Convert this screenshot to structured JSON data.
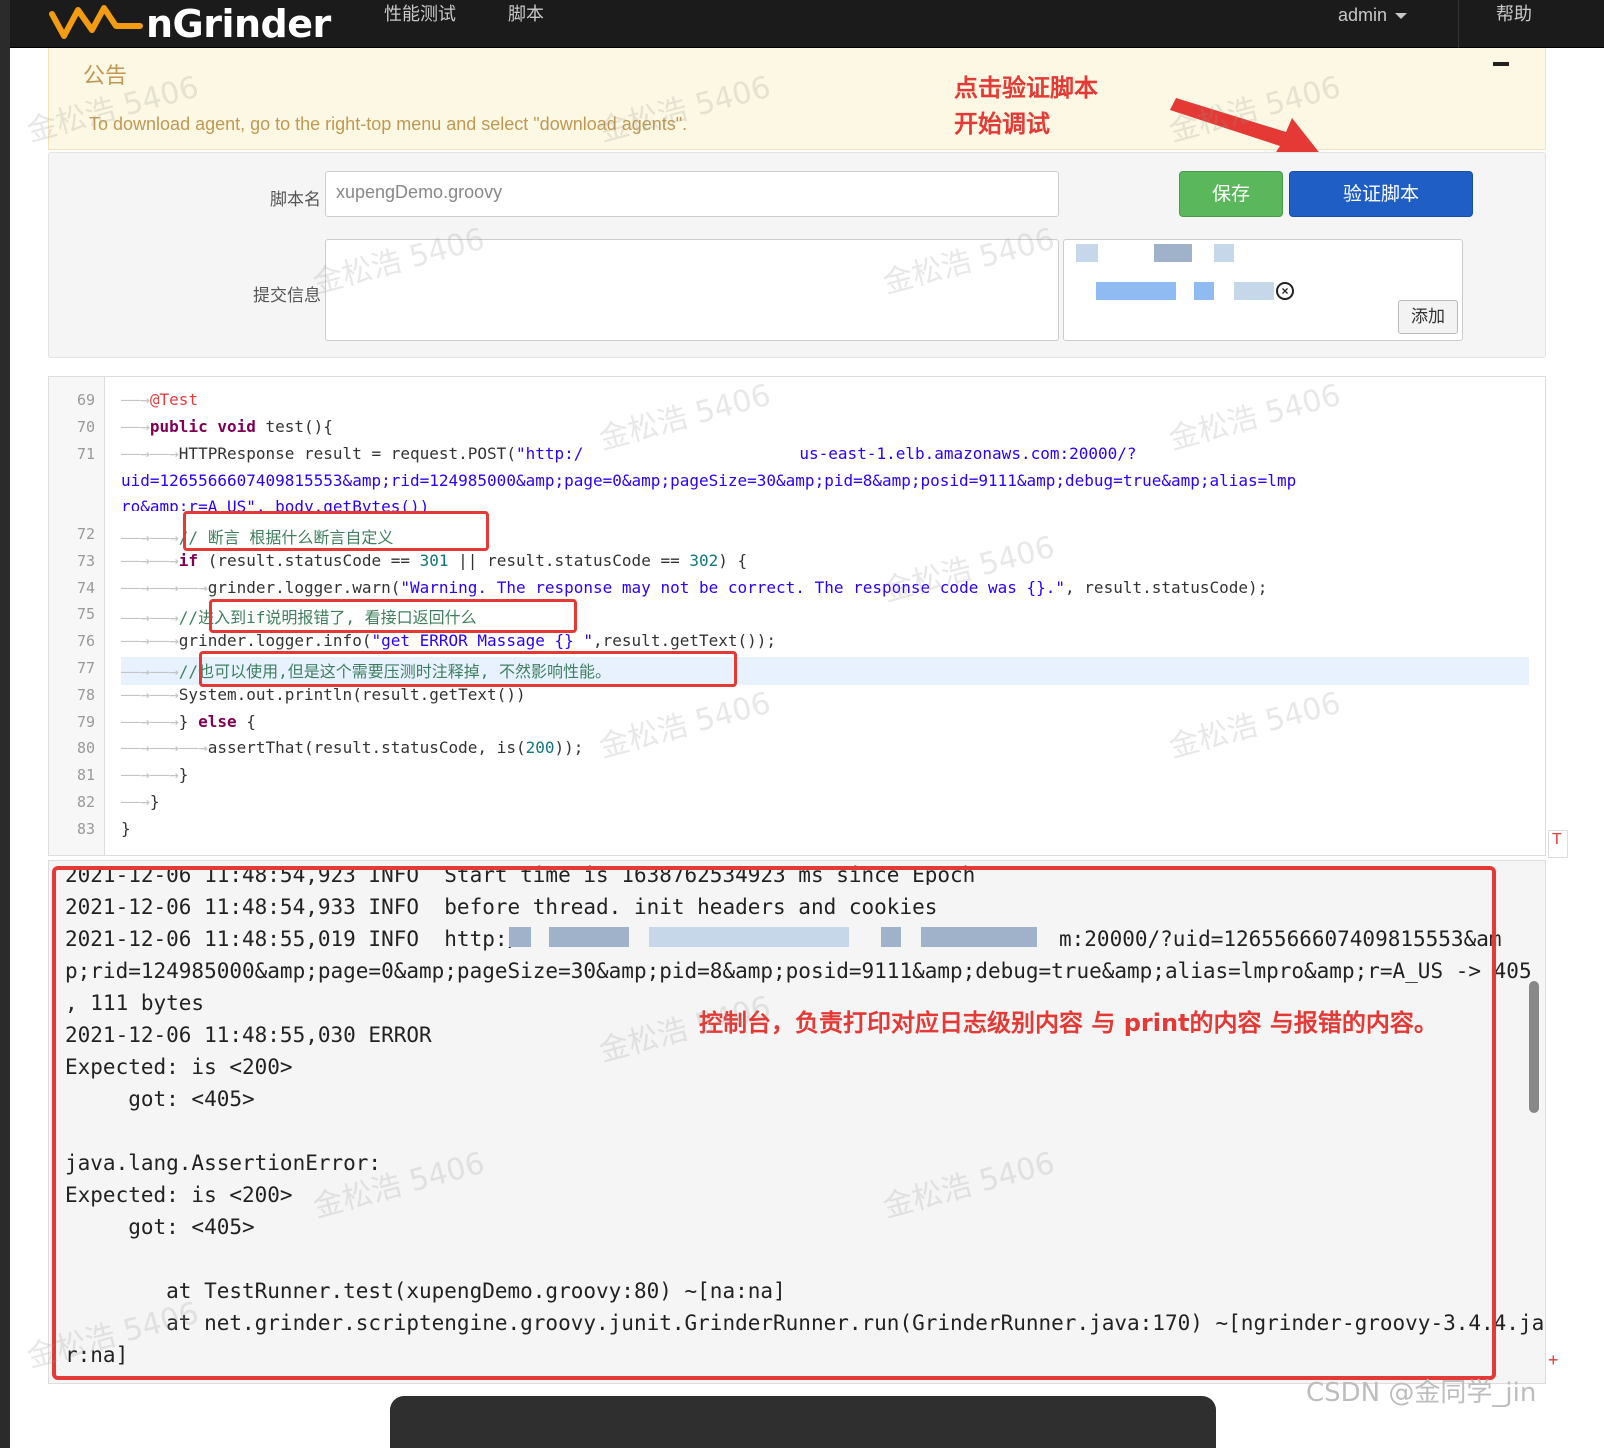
{
  "navbar": {
    "brand": "nGrinder",
    "menu": [
      "性能测试",
      "脚本"
    ],
    "user": "admin",
    "help": "帮助"
  },
  "notice": {
    "title": "公告",
    "text": "To download agent, go to the right-top menu and select \"download agents\"."
  },
  "annotations": {
    "verify_hint_1": "点击验证脚本",
    "verify_hint_2": "开始调试",
    "console_hint": "控制台，负责打印对应日志级别内容 与 print的内容 与报错的内容。"
  },
  "form": {
    "script_name_label": "脚本名",
    "script_name_value": "xupengDemo.groovy",
    "commit_label": "提交信息",
    "commit_value": "",
    "save_label": "保存",
    "verify_label": "验证脚本",
    "add_label": "添加"
  },
  "editor": {
    "line_numbers": [
      "69",
      "70",
      "71",
      "72",
      "73",
      "74",
      "75",
      "76",
      "77",
      "78",
      "79",
      "80",
      "81",
      "82",
      "83"
    ],
    "lines": {
      "l69_annotation": "@Test",
      "l70_kw": "public void",
      "l70_rest": " test(){",
      "l71_a": "HTTPResponse result = request.POST(",
      "l71_url1": "\"http:/",
      "l71_url2": "us-east-1.elb.amazonaws.com:20000/?",
      "l71_cont": "uid=1265566607409815553&amp;rid=124985000&amp;page=0&amp;pageSize=30&amp;pid=8&amp;posid=9111&amp;debug=true&amp;alias=lmp",
      "l71_cont2": "ro&amp;r=A_US\", body.getBytes())",
      "l72_comment": "// 断言 根据什么断言自定义",
      "l73_kw": "if",
      "l73_a": " (result.statusCode == ",
      "l73_n1": "301",
      "l73_b": " || result.statusCode == ",
      "l73_n2": "302",
      "l73_c": ") {",
      "l74_a": "grinder.logger.warn(",
      "l74_str": "\"Warning. The response may not be correct. The response code was {}.\"",
      "l74_b": ", result.statusCode);",
      "l75_comment": "//进入到if说明报错了, 看接口返回什么",
      "l76_a": "grinder.logger.info(",
      "l76_str": "\"get ERROR Massage {} \"",
      "l76_b": ",result.getText());",
      "l77_comment": "//也可以使用,但是这个需要压测时注释掉, 不然影响性能。",
      "l78": "System.out.println(result.getText())",
      "l79_a": "} ",
      "l79_kw": "else",
      "l79_b": " {",
      "l80_a": "assertThat(result.statusCode, is(",
      "l80_n": "200",
      "l80_b": "));",
      "l81": "}",
      "l82": "}",
      "l83": "}"
    }
  },
  "console": {
    "lines": [
      "2021-12-06 11:48:54,923 INFO  Start time is 1638762534923 ms since Epoch",
      "2021-12-06 11:48:54,933 INFO  before thread. init headers and cookies",
      "2021-12-06 11:48:55,019 INFO  http:/",
      "m:20000/?uid=1265566607409815553&am",
      "p;rid=124985000&amp;page=0&amp;pageSize=30&amp;pid=8&amp;posid=9111&amp;debug=true&amp;alias=lmpro&amp;r=A_US -> 405",
      ", 111 bytes",
      "2021-12-06 11:48:55,030 ERROR",
      "Expected: is <200>",
      "     got: <405>",
      "",
      "java.lang.AssertionError:",
      "Expected: is <200>",
      "     got: <405>",
      "",
      "        at TestRunner.test(xupengDemo.groovy:80) ~[na:na]",
      "        at net.grinder.scriptengine.groovy.junit.GrinderRunner.run(GrinderRunner.java:170) ~[ngrinder-groovy-3.4.4.ja",
      "r:na]"
    ]
  },
  "watermark_text": "金松浩 5406",
  "footer_credit": "CSDN @金同学_jin",
  "colors": {
    "annotation_red": "#e53935",
    "save_green": "#5bb75b",
    "verify_blue": "#1f5fc5",
    "notice_bg": "#fcf8e3"
  }
}
